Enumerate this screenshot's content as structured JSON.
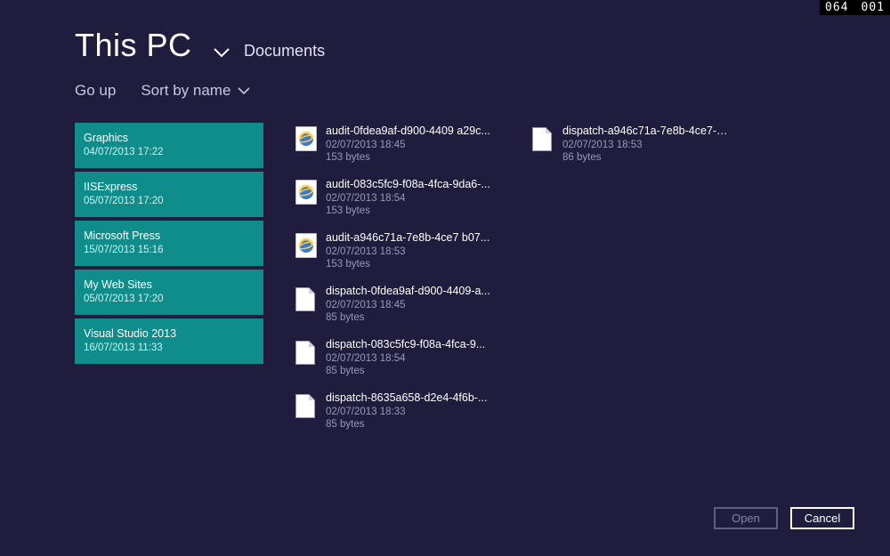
{
  "debug": {
    "a": "064",
    "b": "001"
  },
  "header": {
    "location": "This PC",
    "sub": "Documents"
  },
  "toolbar": {
    "goUp": "Go up",
    "sort": "Sort by name"
  },
  "folders": [
    {
      "name": "Graphics",
      "date": "04/07/2013 17:22"
    },
    {
      "name": "IISExpress",
      "date": "05/07/2013 17:20"
    },
    {
      "name": "Microsoft Press",
      "date": "15/07/2013 15:16"
    },
    {
      "name": "My Web Sites",
      "date": "05/07/2013 17:20"
    },
    {
      "name": "Visual Studio 2013",
      "date": "16/07/2013 11:33"
    }
  ],
  "filesCol2": [
    {
      "icon": "ie",
      "name": "audit-0fdea9af-d900-4409 a29c...",
      "date": "02/07/2013 18:45",
      "size": "153 bytes"
    },
    {
      "icon": "ie",
      "name": "audit-083c5fc9-f08a-4fca-9da6-...",
      "date": "02/07/2013 18:54",
      "size": "153 bytes"
    },
    {
      "icon": "ie",
      "name": "audit-a946c71a-7e8b-4ce7 b07...",
      "date": "02/07/2013 18:53",
      "size": "153 bytes"
    },
    {
      "icon": "doc",
      "name": "dispatch-0fdea9af-d900-4409-a...",
      "date": "02/07/2013 18:45",
      "size": "85 bytes"
    },
    {
      "icon": "doc",
      "name": "dispatch-083c5fc9-f08a-4fca-9...",
      "date": "02/07/2013 18:54",
      "size": "85 bytes"
    },
    {
      "icon": "doc",
      "name": "dispatch-8635a658-d2e4-4f6b-...",
      "date": "02/07/2013 18:33",
      "size": "85 bytes"
    }
  ],
  "filesCol3": [
    {
      "icon": "doc",
      "name": "dispatch-a946c71a-7e8b-4ce7-b...",
      "date": "02/07/2013 18:53",
      "size": "86 bytes"
    }
  ],
  "buttons": {
    "open": "Open",
    "cancel": "Cancel"
  }
}
